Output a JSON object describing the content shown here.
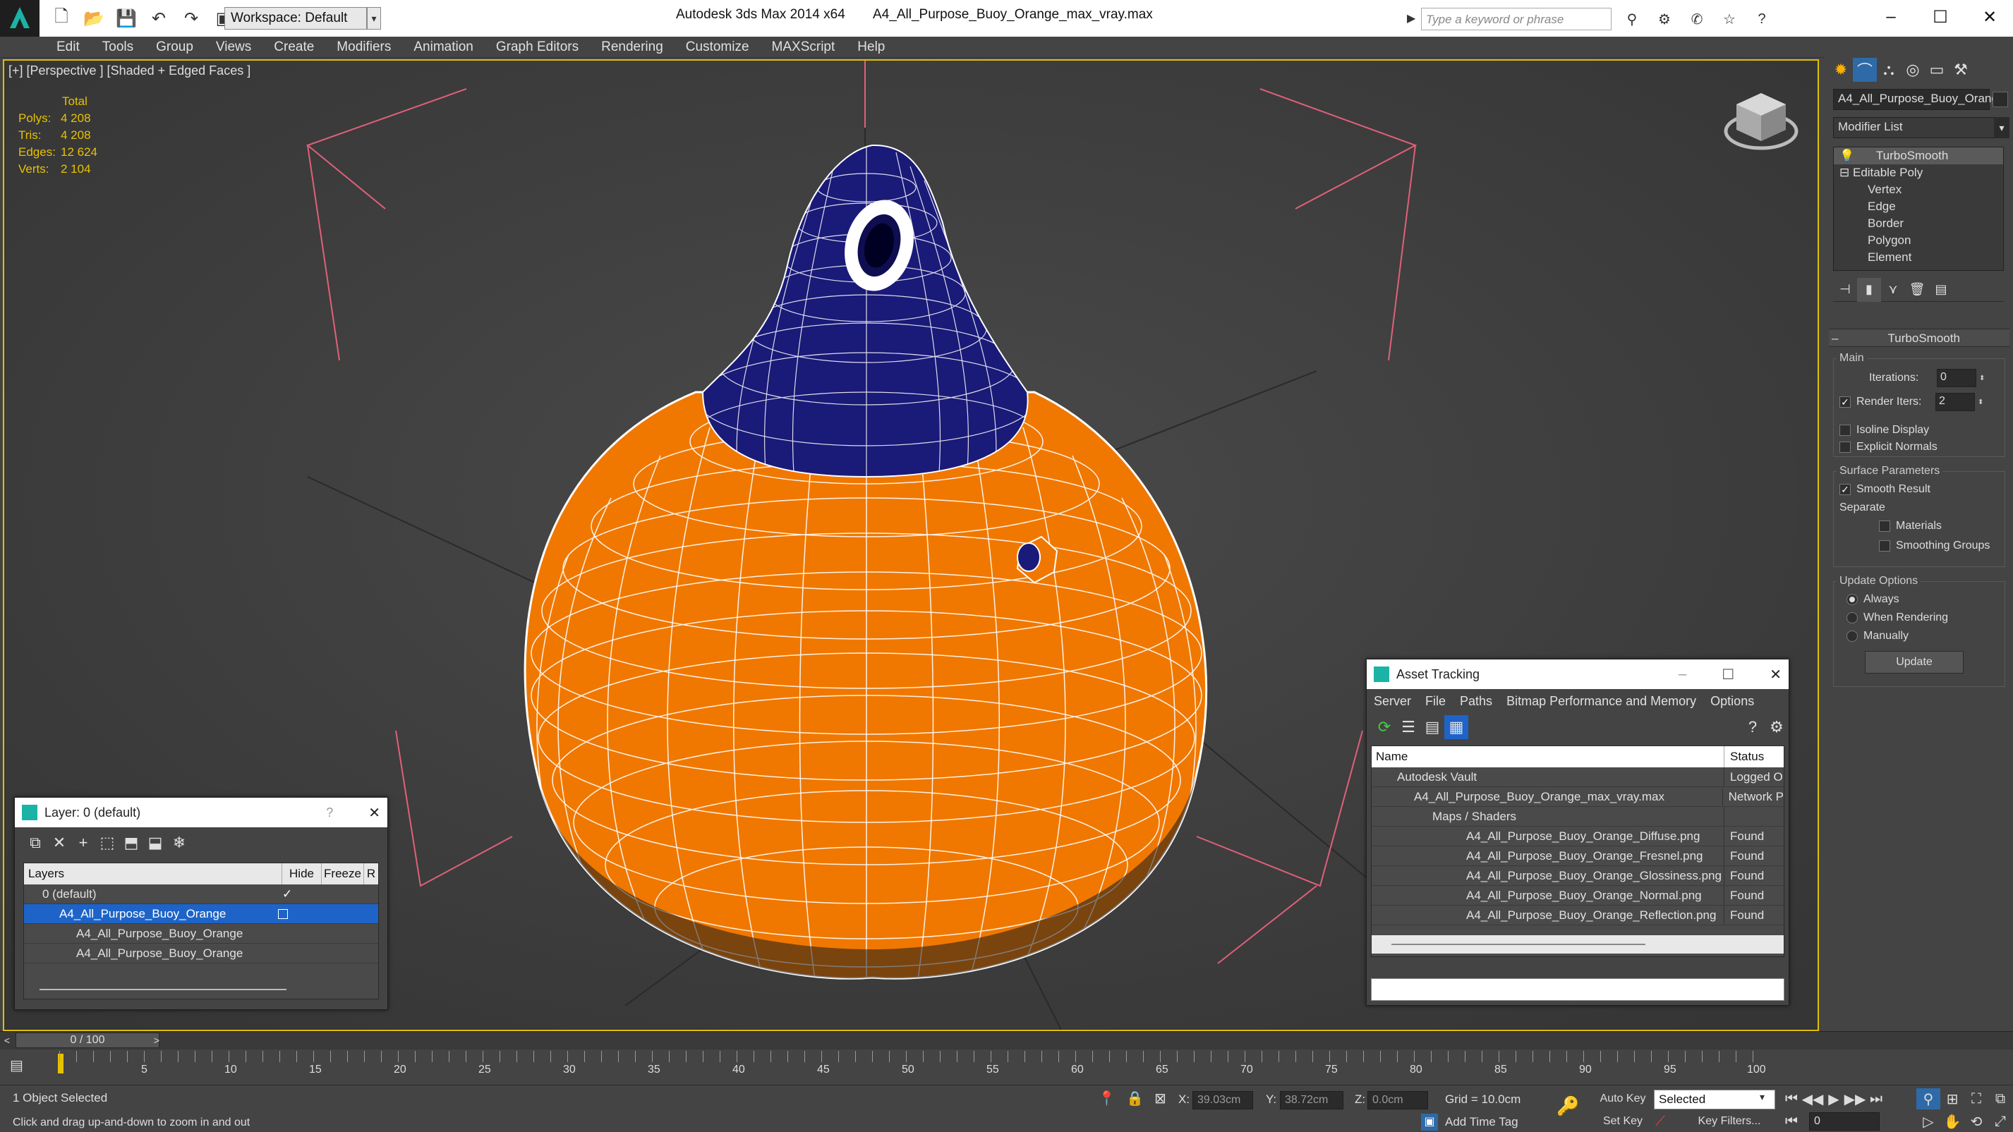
{
  "titlebar": {
    "workspace_label": "Workspace: Default",
    "app_title": "Autodesk 3ds Max  2014 x64",
    "file_title": "A4_All_Purpose_Buoy_Orange_max_vray.max",
    "search_placeholder": "Type a keyword or phrase"
  },
  "menu": [
    "Edit",
    "Tools",
    "Group",
    "Views",
    "Create",
    "Modifiers",
    "Animation",
    "Graph Editors",
    "Rendering",
    "Customize",
    "MAXScript",
    "Help"
  ],
  "viewport": {
    "label": "[+] [Perspective ] [Shaded + Edged Faces ]",
    "stats": {
      "header": "Total",
      "rows": [
        {
          "k": "Polys:",
          "v": "4 208"
        },
        {
          "k": "Tris:",
          "v": "4 208"
        },
        {
          "k": "Edges:",
          "v": "12 624"
        },
        {
          "k": "Verts:",
          "v": "2 104"
        }
      ]
    }
  },
  "command_panel": {
    "object_name": "A4_All_Purpose_Buoy_Orang",
    "modifier_list": "Modifier List",
    "stack": [
      "TurboSmooth",
      "Editable Poly",
      "Vertex",
      "Edge",
      "Border",
      "Polygon",
      "Element"
    ],
    "rollout_title": "TurboSmooth",
    "main_group": "Main",
    "iterations_label": "Iterations:",
    "iterations_value": "0",
    "render_iters_label": "Render Iters:",
    "render_iters_value": "2",
    "isoline_label": "Isoline Display",
    "explicit_normals_label": "Explicit Normals",
    "surface_group": "Surface Parameters",
    "smooth_result_label": "Smooth Result",
    "separate_label": "Separate",
    "materials_label": "Materials",
    "smoothing_groups_label": "Smoothing Groups",
    "update_group": "Update Options",
    "always_label": "Always",
    "when_rendering_label": "When Rendering",
    "manually_label": "Manually",
    "update_button": "Update"
  },
  "layer_window": {
    "title": "Layer: 0 (default)",
    "help": "?",
    "columns": [
      "Layers",
      "Hide",
      "Freeze",
      "R"
    ],
    "rows": [
      {
        "name": "0 (default)",
        "indent": 0
      },
      {
        "name": "A4_All_Purpose_Buoy_Orange",
        "indent": 0
      },
      {
        "name": "A4_All_Purpose_Buoy_Orange",
        "indent": 1
      },
      {
        "name": "A4_All_Purpose_Buoy_Orange",
        "indent": 1
      }
    ]
  },
  "asset_window": {
    "title": "Asset Tracking",
    "menus": [
      "Server",
      "File",
      "Paths",
      "Bitmap Performance and Memory",
      "Options"
    ],
    "columns": [
      "Name",
      "Status"
    ],
    "rows": [
      {
        "name": "Autodesk Vault",
        "status": "Logged O",
        "indent": 1
      },
      {
        "name": "A4_All_Purpose_Buoy_Orange_max_vray.max",
        "status": "Network P",
        "indent": 2
      },
      {
        "name": "Maps / Shaders",
        "status": "",
        "indent": 3
      },
      {
        "name": "A4_All_Purpose_Buoy_Orange_Diffuse.png",
        "status": "Found",
        "indent": 4
      },
      {
        "name": "A4_All_Purpose_Buoy_Orange_Fresnel.png",
        "status": "Found",
        "indent": 4
      },
      {
        "name": "A4_All_Purpose_Buoy_Orange_Glossiness.png",
        "status": "Found",
        "indent": 4
      },
      {
        "name": "A4_All_Purpose_Buoy_Orange_Normal.png",
        "status": "Found",
        "indent": 4
      },
      {
        "name": "A4_All_Purpose_Buoy_Orange_Reflection.png",
        "status": "Found",
        "indent": 4
      }
    ]
  },
  "timeline": {
    "frame_label": "0 / 100",
    "ticks": [
      "5",
      "10",
      "15",
      "20",
      "25",
      "30",
      "35",
      "40",
      "45",
      "50",
      "55",
      "60",
      "65",
      "70",
      "75",
      "80",
      "85",
      "90",
      "95",
      "100"
    ]
  },
  "status": {
    "selection": "1 Object Selected",
    "prompt": "Click and drag up-and-down to zoom in and out",
    "x_label": "X:",
    "x_value": "39.03cm",
    "y_label": "Y:",
    "y_value": "38.72cm",
    "z_label": "Z:",
    "z_value": "0.0cm",
    "grid": "Grid = 10.0cm",
    "auto_key": "Auto Key",
    "selected_option": "Selected",
    "set_key": "Set Key",
    "key_filters": "Key Filters...",
    "add_time_tag": "Add Time Tag",
    "frame_value": "0"
  },
  "colors": {
    "orange": "#f07800",
    "navy": "#1a1a78",
    "gizmo": "#e0607a",
    "accent": "#e6c200",
    "selection": "#1e64c8"
  }
}
